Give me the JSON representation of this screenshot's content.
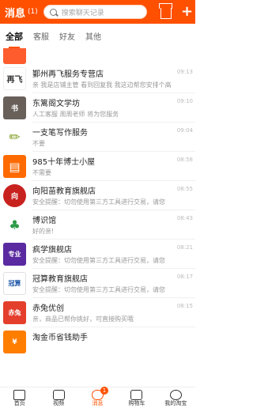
{
  "header": {
    "title": "消息",
    "count": "(1)",
    "search_placeholder": "搜索聊天记录"
  },
  "tabs": [
    "全部",
    "客服",
    "好友",
    "其他"
  ],
  "messages": [
    {
      "name": "",
      "preview": "",
      "time": ""
    },
    {
      "name": "鄞州再飞服务专营店",
      "preview": "亲 我是店铺主管 看到回复我 我这边帮您安排个高",
      "time": "09:13"
    },
    {
      "name": "东篱阁文学坊",
      "preview": "人工客服 周周老师 将为您服务",
      "time": "09:10"
    },
    {
      "name": "一支笔写作服务",
      "preview": "不要",
      "time": "09:04"
    },
    {
      "name": "985十年博士小屋",
      "preview": "不需要",
      "time": "08:58"
    },
    {
      "name": "向阳苗教育旗舰店",
      "preview": "安全提醒：切勿使用第三方工具进行交易，请您",
      "time": "08:55"
    },
    {
      "name": "博识馆",
      "preview": "好的亲!",
      "time": "08:43"
    },
    {
      "name": "疯学旗舰店",
      "preview": "安全提醒：切勿使用第三方工具进行交易，请您",
      "time": "08:21"
    },
    {
      "name": "冠算教育旗舰店",
      "preview": "安全提醒：切勿使用第三方工具进行交易，请您",
      "time": "08:17"
    },
    {
      "name": "赤兔优创",
      "preview": "亲，商品已帮你挑好，可直接购买哦",
      "time": "08:15"
    },
    {
      "name": "淘金币省钱助手",
      "preview": "",
      "time": ""
    }
  ],
  "bottom_nav": [
    {
      "label": "首页"
    },
    {
      "label": "视频"
    },
    {
      "label": "消息",
      "badge": "1"
    },
    {
      "label": "购物车"
    },
    {
      "label": "我的淘宝"
    }
  ],
  "colors": {
    "brand": "#ff5000"
  }
}
